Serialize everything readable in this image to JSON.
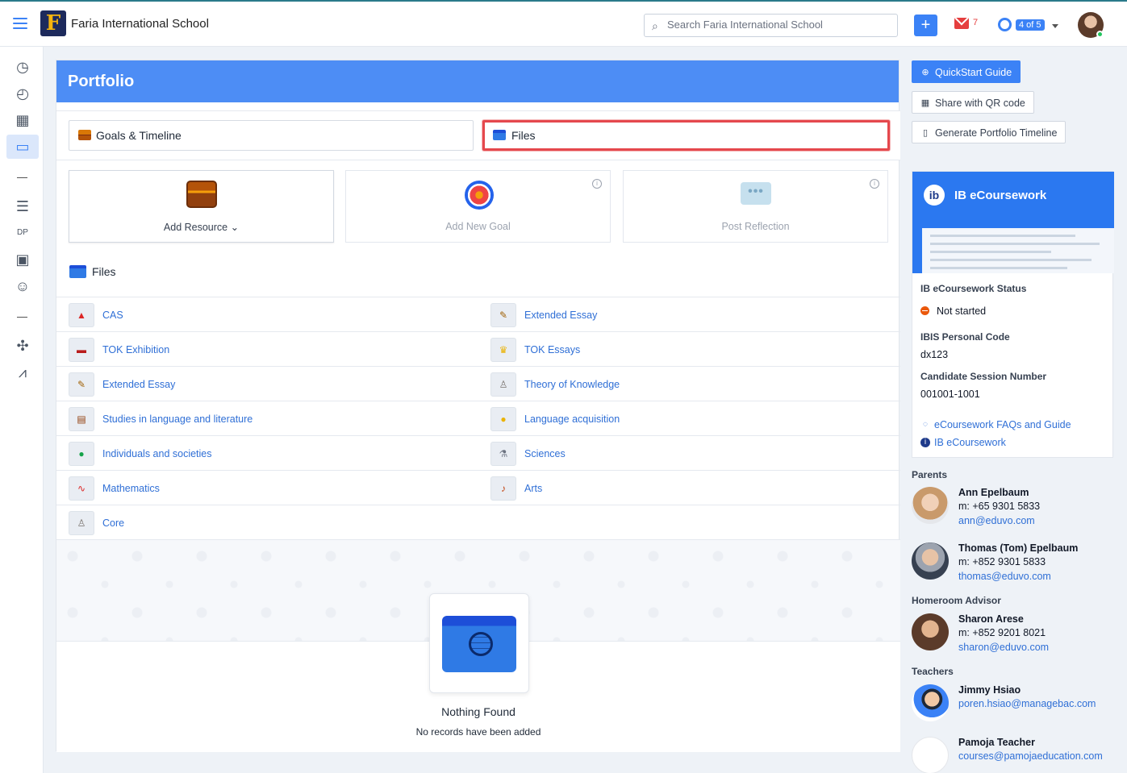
{
  "app": {
    "school_name": "Faria International School",
    "logo_letter": "F",
    "search_placeholder": "Search Faria International School",
    "plus_label": "+",
    "mail_count": "7",
    "page_counter": "4 of 5"
  },
  "sidebar": {
    "items": [
      {
        "name": "dashboard-icon",
        "glyph": "◷"
      },
      {
        "name": "clock-icon",
        "glyph": "◴"
      },
      {
        "name": "calendar-icon",
        "glyph": "▦"
      },
      {
        "name": "portfolio-icon",
        "glyph": "▭",
        "active": true
      },
      {
        "name": "list-icon",
        "glyph": "☰"
      },
      {
        "name": "dp-icon",
        "glyph": "DP"
      },
      {
        "name": "presentation-icon",
        "glyph": "▣"
      },
      {
        "name": "people-icon",
        "glyph": "☺"
      },
      {
        "name": "network-icon",
        "glyph": "✣"
      },
      {
        "name": "chart-icon",
        "glyph": "⩘"
      }
    ]
  },
  "main": {
    "title": "Portfolio",
    "tabs": {
      "goals": "Goals & Timeline",
      "files": "Files"
    },
    "actions": {
      "add_resource": "Add Resource",
      "add_goal": "Add New Goal",
      "post_reflection": "Post Reflection",
      "info_glyph": "i",
      "reflection_glyph": "•••"
    },
    "files_heading": "Files",
    "files_left": [
      {
        "label": "CAS",
        "glyph": "▲"
      },
      {
        "label": "TOK Exhibition",
        "glyph": "▬"
      },
      {
        "label": "Extended Essay",
        "glyph": "✎"
      },
      {
        "label": "Studies in language and literature",
        "glyph": "▤"
      },
      {
        "label": "Individuals and societies",
        "glyph": "●"
      },
      {
        "label": "Mathematics",
        "glyph": "∿"
      },
      {
        "label": "Core",
        "glyph": "♙"
      }
    ],
    "files_right": [
      {
        "label": "Extended Essay",
        "glyph": "✎"
      },
      {
        "label": "TOK Essays",
        "glyph": "♛"
      },
      {
        "label": "Theory of Knowledge",
        "glyph": "♙"
      },
      {
        "label": "Language acquisition",
        "glyph": "●"
      },
      {
        "label": "Sciences",
        "glyph": "⚗"
      },
      {
        "label": "Arts",
        "glyph": "♪"
      }
    ],
    "empty_title": "Nothing Found",
    "empty_subtitle": "No records have been added"
  },
  "right": {
    "buttons": {
      "quickstart": "QuickStart Guide",
      "qr": "Share with QR code",
      "timeline": "Generate Portfolio Timeline"
    },
    "ib": {
      "title": "IB eCoursework",
      "logo": "ib",
      "status_label": "IB eCoursework Status",
      "status_value": "Not started",
      "code_label": "IBIS Personal Code",
      "code_value": "dx123",
      "session_label": "Candidate Session Number",
      "session_value": "001001-1001",
      "faq_link": "eCoursework FAQs and Guide",
      "ib_link": "IB eCoursework"
    },
    "parents_label": "Parents",
    "parents": [
      {
        "name": "Ann Epelbaum",
        "phone": "m: +65 9301 5833",
        "email": "ann@eduvo.com"
      },
      {
        "name": "Thomas (Tom) Epelbaum",
        "phone": "m: +852 9301 5833",
        "email": "thomas@eduvo.com"
      }
    ],
    "advisor_label": "Homeroom Advisor",
    "advisor": {
      "name": "Sharon Arese",
      "phone": "m: +852 9201 8021",
      "email": "sharon@eduvo.com"
    },
    "teachers_label": "Teachers",
    "teachers": [
      {
        "name": "Jimmy Hsiao",
        "email": "poren.hsiao@managebac.com"
      },
      {
        "name": "Pamoja Teacher",
        "email": "courses@pamojaeducation.com"
      }
    ]
  }
}
